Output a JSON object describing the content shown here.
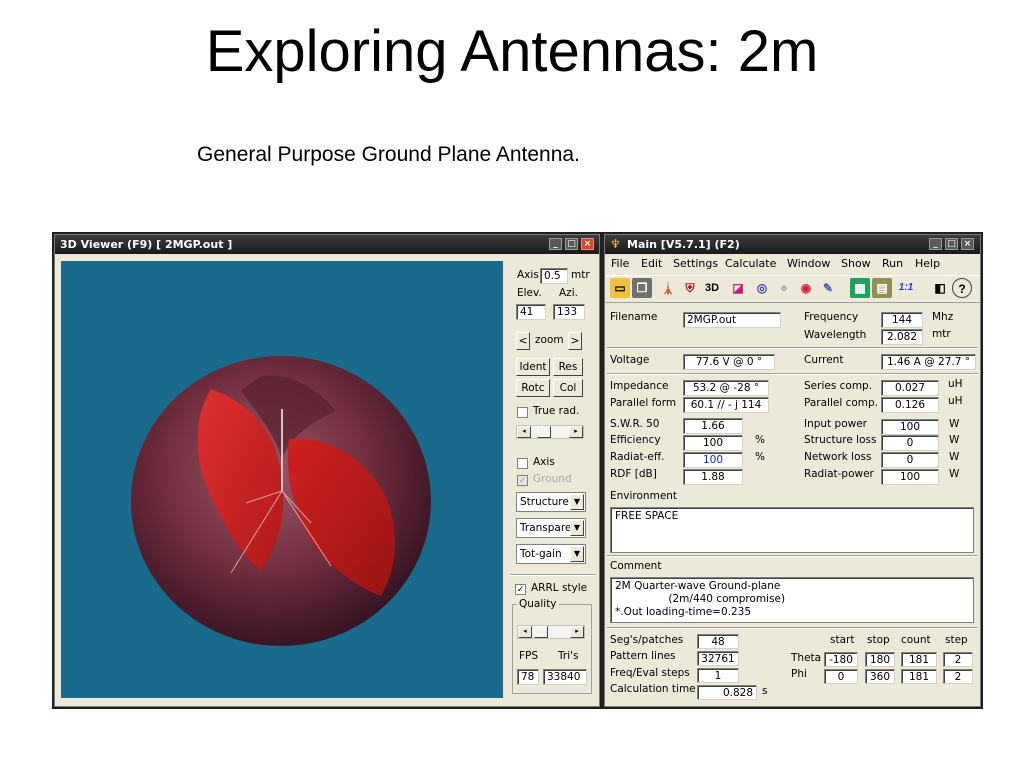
{
  "slide": {
    "title": "Exploring Antennas: 2m",
    "subtitle": "General Purpose Ground Plane Antenna."
  },
  "viewer": {
    "title": "3D Viewer (F9)    [  2MGP.out ]",
    "axis_label": "Axis",
    "axis_value": "0.5",
    "axis_unit": "mtr",
    "elev_label": "Elev.",
    "azi_label": "Azi.",
    "elev_value": "41",
    "azi_value": "133",
    "zoom_label": "zoom",
    "zoom_left": "<",
    "zoom_right": ">",
    "ident_label": "Ident",
    "res_label": "Res",
    "rotc_label": "Rotc",
    "col_label": "Col",
    "true_rad_label": "True rad.",
    "axis_check_label": "Axis",
    "ground_label": "Ground",
    "structure_combo": "Structure",
    "transparent_combo": "Transpare",
    "totgain_combo": "Tot-gain",
    "arrl_label": "ARRL style",
    "quality_label": "Quality",
    "fps_label": "FPS",
    "tris_label": "Tri's",
    "fps_value": "78",
    "tris_value": "33840",
    "colors": {
      "canvas": "#1a6a8c",
      "pattern_outer": "#7a3344",
      "pattern_inner": "#d42020"
    }
  },
  "main": {
    "title": "Main [V5.7.1]  (F2)",
    "menu": [
      "File",
      "Edit",
      "Settings",
      "Calculate",
      "Window",
      "Show",
      "Run",
      "Help"
    ],
    "toolbar_icons": [
      "folder-open-icon",
      "copy-icon",
      "antenna-icon",
      "shield-icon",
      "3d-icon",
      "chart-icon",
      "target-icon",
      "grid-icon",
      "sphere-icon",
      "tools-icon",
      "calculator-icon",
      "stack-icon",
      "ratio-icon",
      "book-icon",
      "help-icon"
    ],
    "toolbar_glyphs": [
      "▭",
      "❐",
      "🗼",
      "⛨",
      "3D",
      "◪",
      "◎",
      "⋄",
      "◉",
      "✎",
      "▦",
      "▤",
      "1:1",
      "◧",
      "?"
    ],
    "filename_label": "Filename",
    "filename_value": "2MGP.out",
    "frequency_label": "Frequency",
    "frequency_value": "144",
    "frequency_unit": "Mhz",
    "wavelength_label": "Wavelength",
    "wavelength_value": "2.082",
    "wavelength_unit": "mtr",
    "voltage_label": "Voltage",
    "voltage_value": "77.6 V @ 0 °",
    "current_label": "Current",
    "current_value": "1.46 A @ 27.7 °",
    "impedance_label": "Impedance",
    "impedance_value": "53.2 @ -28 °",
    "parallel_form_label": "Parallel form",
    "parallel_form_value": "60.1 // - j 114",
    "series_comp_label": "Series comp.",
    "series_comp_value": "0.027",
    "series_comp_unit": "uH",
    "parallel_comp_label": "Parallel comp.",
    "parallel_comp_value": "0.126",
    "parallel_comp_unit": "uH",
    "swr_label": "S.W.R. 50",
    "swr_value": "1.66",
    "efficiency_label": "Efficiency",
    "efficiency_value": "100",
    "efficiency_unit": "%",
    "radiat_eff_label": "Radiat-eff.",
    "radiat_eff_value": "100",
    "radiat_eff_unit": "%",
    "rdf_label": "RDF [dB]",
    "rdf_value": "1.88",
    "input_power_label": "Input power",
    "input_power_value": "100",
    "input_power_unit": "W",
    "structure_loss_label": "Structure loss",
    "structure_loss_value": "0",
    "structure_loss_unit": "W",
    "network_loss_label": "Network loss",
    "network_loss_value": "0",
    "network_loss_unit": "W",
    "radiat_power_label": "Radiat-power",
    "radiat_power_value": "100",
    "radiat_power_unit": "W",
    "environment_label": "Environment",
    "environment_value": "FREE SPACE",
    "comment_label": "Comment",
    "comment_value": "2M Quarter-wave Ground-plane\n                (2m/440 compromise)\n*.Out loading-time=0.235",
    "segs_label": "Seg's/patches",
    "segs_value": "48",
    "pattern_lines_label": "Pattern lines",
    "pattern_lines_value": "32761",
    "freq_eval_label": "Freq/Eval steps",
    "freq_eval_value": "1",
    "calc_time_label": "Calculation time",
    "calc_time_value": "0.828",
    "calc_time_unit": "s",
    "grid_headers": [
      "start",
      "stop",
      "count",
      "step"
    ],
    "theta_label": "Theta",
    "theta_values": [
      "-180",
      "180",
      "181",
      "2"
    ],
    "phi_label": "Phi",
    "phi_values": [
      "0",
      "360",
      "181",
      "2"
    ]
  }
}
